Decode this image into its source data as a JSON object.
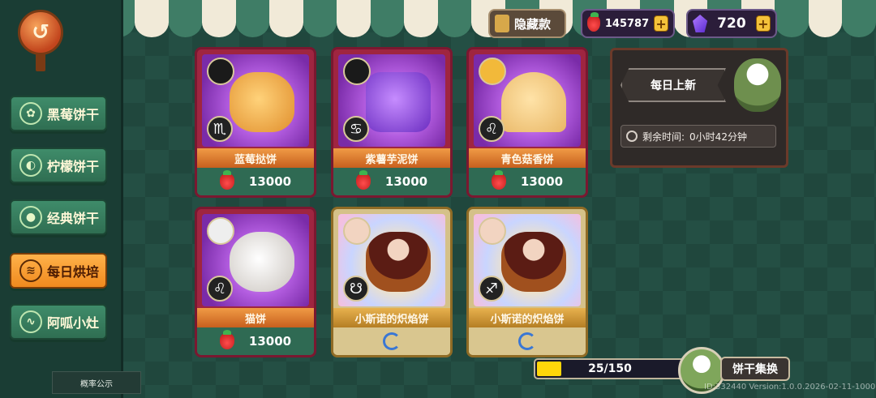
{
  "topbar": {
    "hidden_label": "隐藏款",
    "strawberry_count": "145787",
    "gem_count": "720"
  },
  "sidebar": {
    "items": [
      {
        "label": "黑莓饼干",
        "icon": "blackberry-icon"
      },
      {
        "label": "柠檬饼干",
        "icon": "lemon-icon"
      },
      {
        "label": "经典饼干",
        "icon": "cookie-icon"
      },
      {
        "label": "每日烘培",
        "icon": "steam-oven-icon"
      },
      {
        "label": "阿呱小灶",
        "icon": "wave-icon"
      }
    ],
    "active_index": 3,
    "probability_label": "概率公示"
  },
  "cards": [
    {
      "name": "蓝莓挞饼",
      "price": "13000",
      "sign": "♏",
      "style": "tart",
      "claimed": false
    },
    {
      "name": "紫薯芋泥饼",
      "price": "13000",
      "sign": "♋",
      "style": "purple",
      "claimed": false
    },
    {
      "name": "青色菇香饼",
      "price": "13000",
      "sign": "♌",
      "style": "cracker",
      "claimed": false
    },
    {
      "name": "猫饼",
      "price": "13000",
      "sign": "♌",
      "style": "cat",
      "claimed": false
    },
    {
      "name": "小斯诺的炽焰饼",
      "price": "",
      "sign": "☋",
      "style": "char",
      "claimed": true
    },
    {
      "name": "小斯诺的炽焰饼",
      "price": "",
      "sign": "♐",
      "style": "char",
      "claimed": true
    }
  ],
  "daily": {
    "title": "每日上新",
    "timer_label": "剩余时间:",
    "timer_value": "0小时42分钟"
  },
  "collection": {
    "current": 25,
    "total": 150,
    "progress_text": "25/150",
    "button_label": "饼干集换"
  },
  "version_text": "ID:332440  Version:1.0.0.2026-02-11-1000"
}
